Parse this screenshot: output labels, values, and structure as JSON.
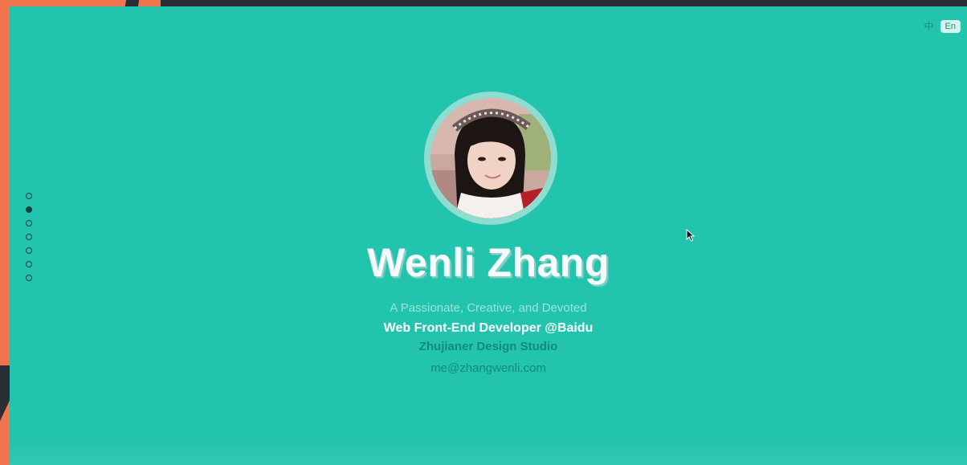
{
  "header": {
    "lang_zh": "中",
    "lang_en": "En"
  },
  "nav_dots": {
    "count": 7,
    "active_index": 1
  },
  "profile": {
    "name": "Wenli Zhang",
    "tagline": "A Passionate, Creative, and Devoted",
    "role": "Web Front-End Developer @Baidu",
    "studio": "Zhujianer Design Studio",
    "email": "me@zhangwenli.com"
  },
  "colors": {
    "background": "#22c4ae",
    "accent_orange": "#f0744d",
    "dark": "#2a2f35"
  }
}
